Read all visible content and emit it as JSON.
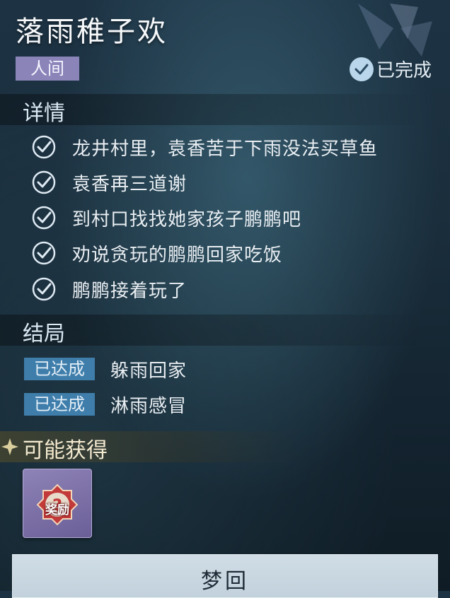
{
  "quest": {
    "title": "落雨稚子欢",
    "tag": "人间",
    "status": "已完成"
  },
  "details": {
    "header": "详情",
    "tasks": [
      "龙井村里，袁香苦于下雨没法买草鱼",
      "袁香再三道谢",
      "到村口找找她家孩子鹏鹏吧",
      "劝说贪玩的鹏鹏回家吃饭",
      "鹏鹏接着玩了"
    ]
  },
  "ending": {
    "header": "结局",
    "items": [
      {
        "badge": "已达成",
        "text": "躲雨回家"
      },
      {
        "badge": "已达成",
        "text": "淋雨感冒"
      }
    ]
  },
  "rewards": {
    "header": "可能获得",
    "item_label": "奖励"
  },
  "actions": {
    "dream_label": "梦回"
  },
  "colors": {
    "tag_bg": "#8a84b8",
    "badge_bg": "#3f7eab",
    "check_stroke": "#dfeaf3",
    "reward_bg": "#7c70a8"
  },
  "icons": {
    "status": "check-circle-icon",
    "task": "check-circle-icon",
    "reward": "question-mark-emblem-icon"
  }
}
